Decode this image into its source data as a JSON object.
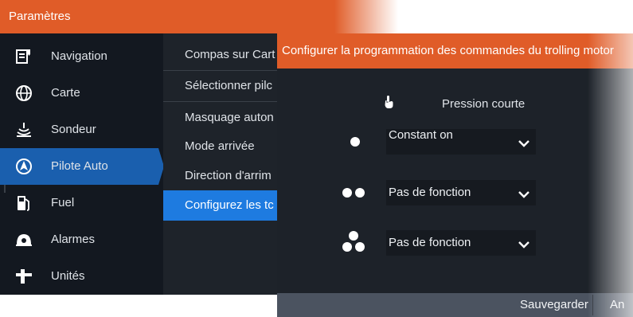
{
  "window": {
    "title": "Paramètres"
  },
  "sidebar": {
    "items": [
      {
        "label": "Navigation",
        "icon": "navigation-icon"
      },
      {
        "label": "Carte",
        "icon": "globe-icon"
      },
      {
        "label": "Sondeur",
        "icon": "sonar-icon"
      },
      {
        "label": "Pilote Auto",
        "icon": "autopilot-icon",
        "selected": true
      },
      {
        "label": "Fuel",
        "icon": "fuel-pump-icon"
      },
      {
        "label": "Alarmes",
        "icon": "alarm-icon"
      },
      {
        "label": "Unités",
        "icon": "units-icon"
      }
    ]
  },
  "submenu": {
    "items": [
      {
        "label": "Compas sur Cart"
      },
      {
        "label": "Sélectionner pilc"
      },
      {
        "label": "Masquage auton"
      },
      {
        "label": "Mode arrivée"
      },
      {
        "label": "Direction d'arrim"
      },
      {
        "label": "Configurez les tc",
        "selected": true
      }
    ]
  },
  "dialog": {
    "title": "Configurer la programmation des commandes du trolling motor",
    "column_header": "Pression courte",
    "column_icon": "hand-pointer-icon",
    "rows": [
      {
        "icon": "single-dot-icon",
        "value": "Constant on"
      },
      {
        "icon": "double-dot-icon",
        "value": "Pas de fonction"
      },
      {
        "icon": "triple-dot-icon",
        "value": "Pas de fonction"
      }
    ],
    "footer": {
      "save_label": "Sauvegarder",
      "cancel_label": "An"
    }
  },
  "colors": {
    "accent_orange": "#e05c28",
    "selected_blue": "#1a5fae",
    "submenu_selected_blue": "#1e7be0",
    "background_dark": "#1c2128"
  }
}
